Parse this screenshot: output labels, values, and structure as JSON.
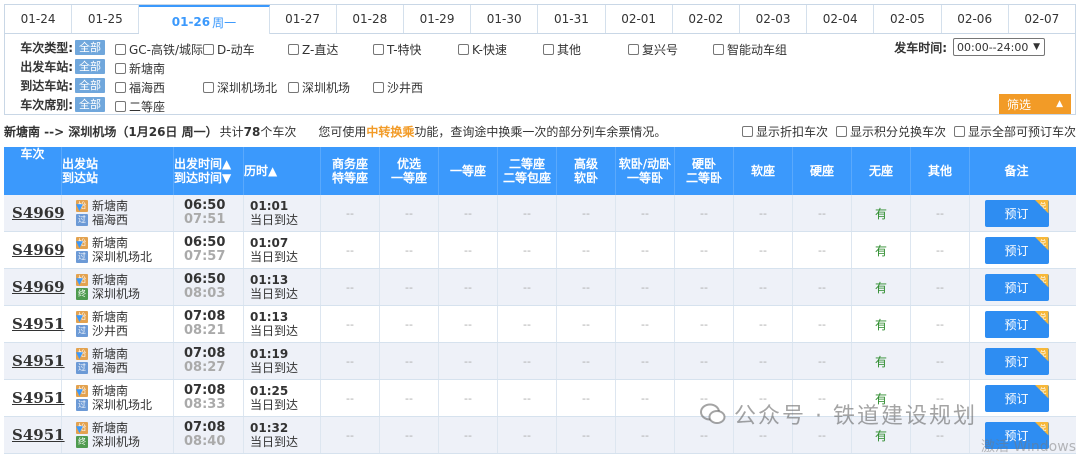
{
  "dates": [
    {
      "label": "01-24"
    },
    {
      "label": "01-25"
    },
    {
      "label": "01-26",
      "weekday": "周一",
      "active": true
    },
    {
      "label": "01-27"
    },
    {
      "label": "01-28"
    },
    {
      "label": "01-29"
    },
    {
      "label": "01-30"
    },
    {
      "label": "01-31"
    },
    {
      "label": "02-01"
    },
    {
      "label": "02-02"
    },
    {
      "label": "02-03"
    },
    {
      "label": "02-04"
    },
    {
      "label": "02-05"
    },
    {
      "label": "02-06"
    },
    {
      "label": "02-07"
    }
  ],
  "filters": {
    "all_label": "全部",
    "train_type": {
      "label": "车次类型:",
      "options": [
        "GC-高铁/城际",
        "D-动车",
        "Z-直达",
        "T-特快",
        "K-快速",
        "其他",
        "复兴号",
        "智能动车组"
      ]
    },
    "from_station": {
      "label": "出发车站:",
      "options": [
        "新塘南"
      ]
    },
    "to_station": {
      "label": "到达车站:",
      "options": [
        "福海西",
        "深圳机场北",
        "深圳机场",
        "沙井西"
      ]
    },
    "seat": {
      "label": "车次席别:",
      "options": [
        "二等座"
      ]
    },
    "depart_time": {
      "label": "发车时间:",
      "value": "00:00--24:00"
    },
    "screen_button": "筛选"
  },
  "summary": {
    "route": "新塘南 --> 深圳机场（1月26日 周一）",
    "count_prefix": "共计",
    "count": "78",
    "count_suffix": "个车次",
    "tip_prefix": "您可使用",
    "tip_link": "中转换乘",
    "tip_suffix": "功能，查询途中换乘一次的部分列车余票情况。",
    "options": [
      "显示折扣车次",
      "显示积分兑换车次",
      "显示全部可预订车次"
    ]
  },
  "table": {
    "headers": {
      "train": "车次",
      "station_1": "出发站",
      "station_2": "到达站",
      "time_1": "出发时间▲",
      "time_2": "到达时间▼",
      "duration": "历时▲",
      "seat_business_1": "商务座",
      "seat_business_2": "特等座",
      "seat_premium_1": "优选",
      "seat_premium_2": "一等座",
      "seat_first": "一等座",
      "seat_second_1": "二等座",
      "seat_second_2": "二等包座",
      "seat_deluxe_1": "高级",
      "seat_deluxe_2": "软卧",
      "seat_soft_sleeper_1": "软卧/动卧",
      "seat_soft_sleeper_2": "一等卧",
      "seat_hard_sleeper_1": "硬卧",
      "seat_hard_sleeper_2": "二等卧",
      "seat_soft": "软座",
      "seat_hard": "硬座",
      "seat_none": "无座",
      "seat_other": "其他",
      "note": "备注"
    },
    "dash": "--",
    "available": "有",
    "book_label": "预订",
    "book_badge": "兑",
    "tags": {
      "start": "始",
      "pass": "过",
      "end": "终"
    },
    "rows": [
      {
        "train": "S4969",
        "from": "新塘南",
        "to": "福海西",
        "to_tag": "pass",
        "dep": "06:50",
        "arr": "07:51",
        "dur": "01:01",
        "day": "当日到达"
      },
      {
        "train": "S4969",
        "from": "新塘南",
        "to": "深圳机场北",
        "to_tag": "pass",
        "dep": "06:50",
        "arr": "07:57",
        "dur": "01:07",
        "day": "当日到达"
      },
      {
        "train": "S4969",
        "from": "新塘南",
        "to": "深圳机场",
        "to_tag": "end",
        "dep": "06:50",
        "arr": "08:03",
        "dur": "01:13",
        "day": "当日到达"
      },
      {
        "train": "S4951",
        "from": "新塘南",
        "to": "沙井西",
        "to_tag": "pass",
        "dep": "07:08",
        "arr": "08:21",
        "dur": "01:13",
        "day": "当日到达"
      },
      {
        "train": "S4951",
        "from": "新塘南",
        "to": "福海西",
        "to_tag": "pass",
        "dep": "07:08",
        "arr": "08:27",
        "dur": "01:19",
        "day": "当日到达"
      },
      {
        "train": "S4951",
        "from": "新塘南",
        "to": "深圳机场北",
        "to_tag": "pass",
        "dep": "07:08",
        "arr": "08:33",
        "dur": "01:25",
        "day": "当日到达"
      },
      {
        "train": "S4951",
        "from": "新塘南",
        "to": "深圳机场",
        "to_tag": "end",
        "dep": "07:08",
        "arr": "08:40",
        "dur": "01:32",
        "day": "当日到达"
      }
    ]
  },
  "watermark": "公众号 · 铁道建设规划",
  "activate_text": "激活 Windows"
}
